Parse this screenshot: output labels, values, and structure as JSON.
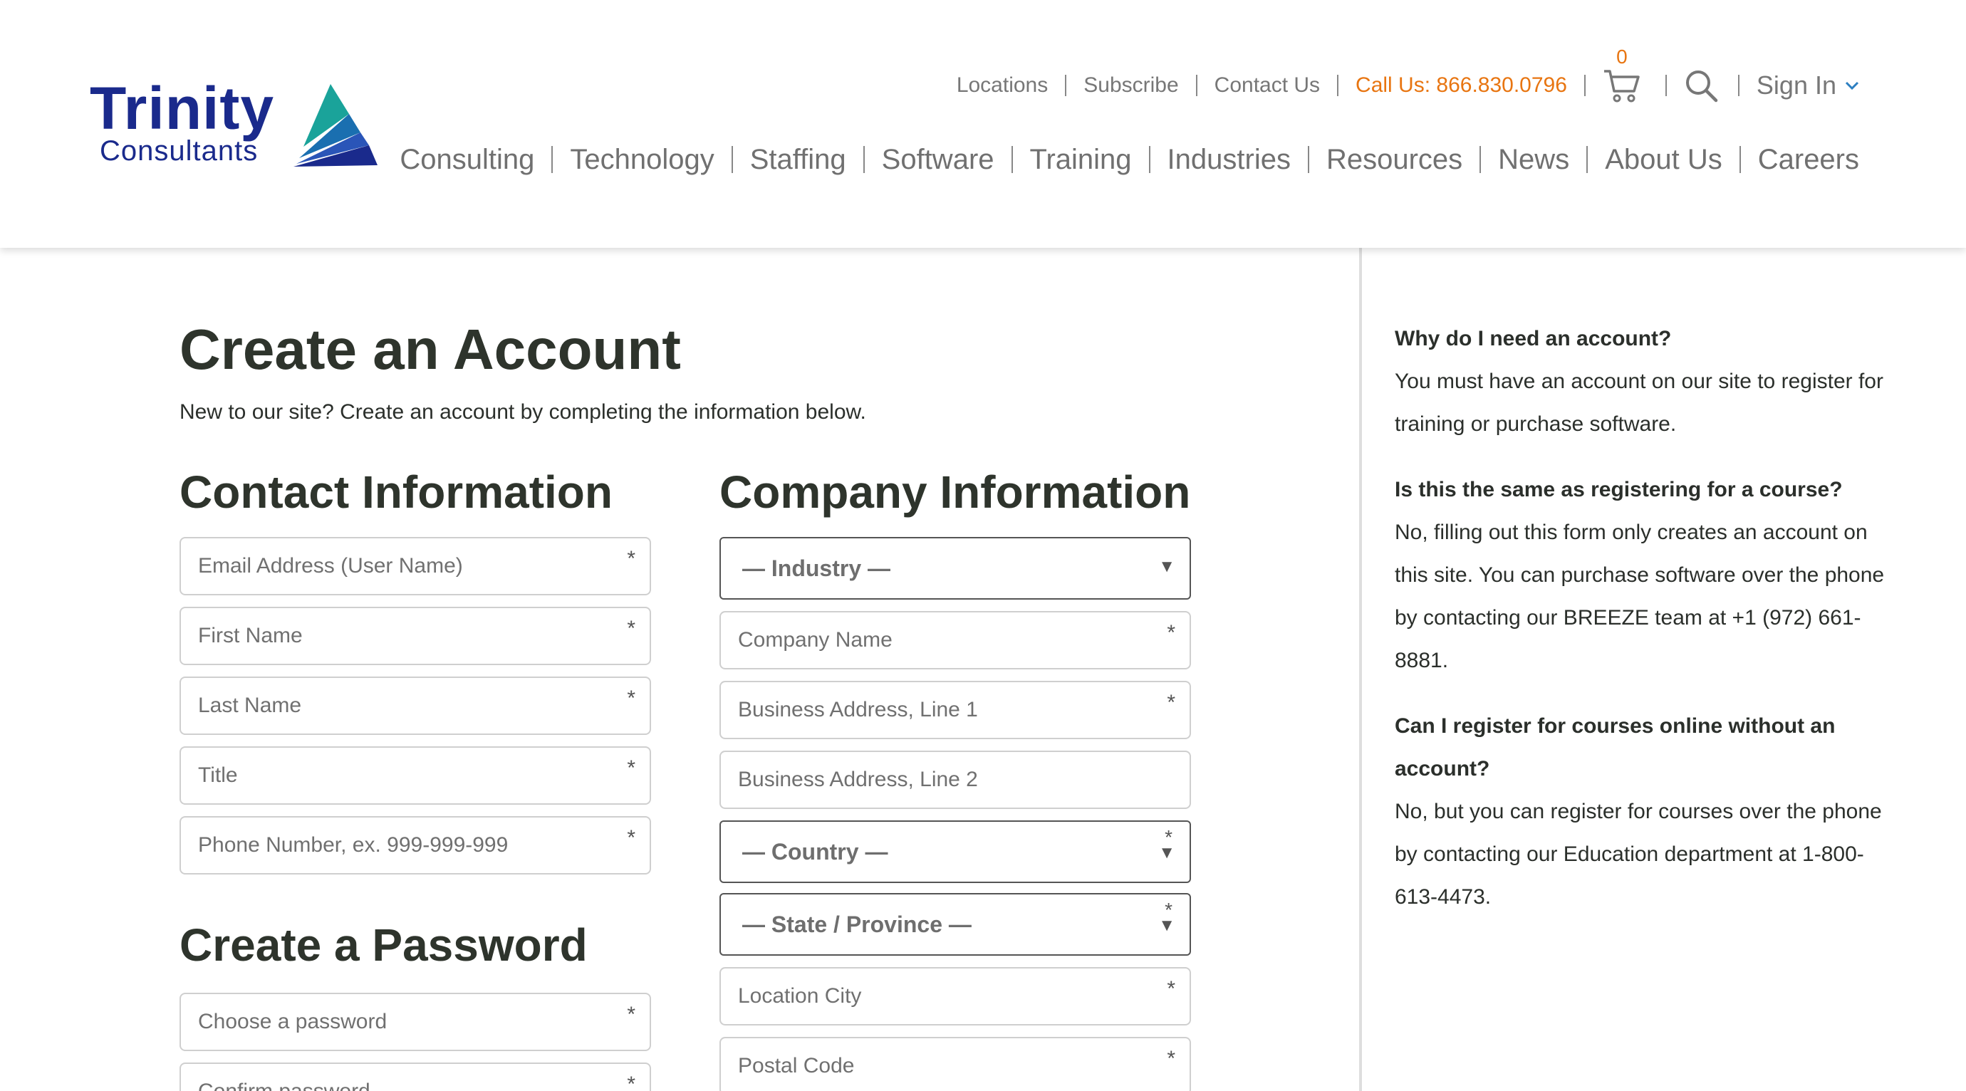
{
  "brand": {
    "name_line1": "Trinity",
    "name_line2": "Consultants",
    "accent_orange": "#e87511",
    "brand_blue": "#1a2a8c",
    "teal": "#1aa39a"
  },
  "utility_nav": {
    "locations": "Locations",
    "subscribe": "Subscribe",
    "contact": "Contact Us",
    "call": "Call Us: 866.830.0796",
    "cart_count": "0",
    "sign_in": "Sign In"
  },
  "main_nav": [
    "Consulting",
    "Technology",
    "Staffing",
    "Software",
    "Training",
    "Industries",
    "Resources",
    "News",
    "About Us",
    "Careers"
  ],
  "page": {
    "title": "Create an Account",
    "subtitle": "New to our site? Create an account by completing the information below."
  },
  "contact": {
    "heading": "Contact Information",
    "fields": [
      {
        "placeholder": "Email Address (User Name)",
        "required": "*"
      },
      {
        "placeholder": "First Name",
        "required": "*"
      },
      {
        "placeholder": "Last Name",
        "required": "*"
      },
      {
        "placeholder": "Title",
        "required": "*"
      },
      {
        "placeholder": "Phone Number, ex. 999-999-999",
        "required": "*"
      }
    ]
  },
  "password": {
    "heading": "Create a Password",
    "fields": [
      {
        "placeholder": "Choose a password",
        "required": "*"
      },
      {
        "placeholder": "Confirm password",
        "required": "*"
      }
    ]
  },
  "company": {
    "heading": "Company Information",
    "industry": "— Industry —",
    "company_name": "Company Name",
    "address1": "Business Address, Line 1",
    "address2": "Business Address, Line 2",
    "country": "— Country —",
    "state": "— State / Province —",
    "city": "Location City",
    "postal": "Postal Code",
    "required": "*"
  },
  "faq": [
    {
      "q": "Why do I need an account?",
      "a": "You must have an account on our site to register for training or purchase software."
    },
    {
      "q": "Is this the same as registering for a course?",
      "a": "No, filling out this form only creates an account on this site. You can purchase software over the phone by contacting our BREEZE team at +1 (972) 661-8881."
    },
    {
      "q": "Can I register for courses online without an account?",
      "a": "No, but you can register for courses over the phone by contacting our Education department at 1-800-613-4473."
    }
  ]
}
